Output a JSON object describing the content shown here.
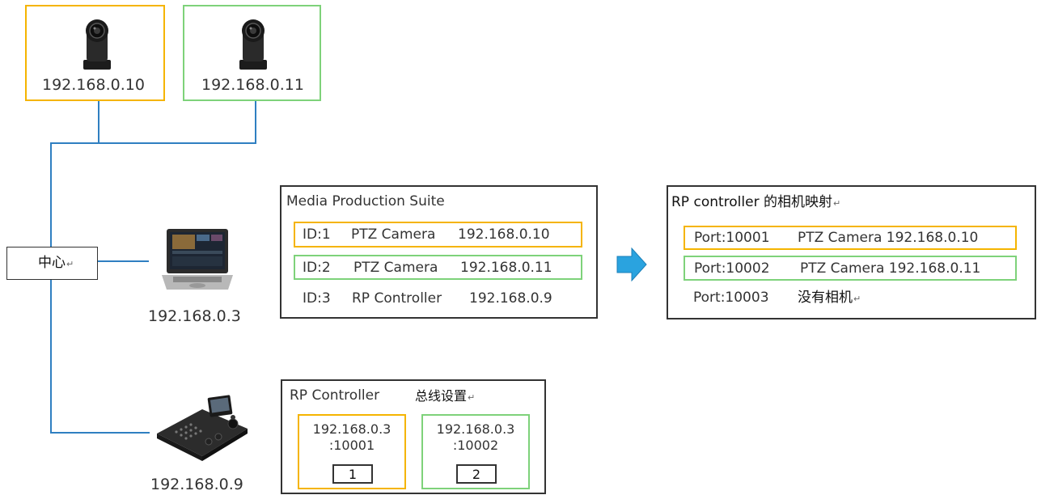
{
  "colors": {
    "orange": "#f5b400",
    "green": "#7ed27a",
    "line_blue": "#2f7fc1",
    "arrow_blue": "#2aa3df",
    "frame": "#333333"
  },
  "cameras": [
    {
      "ip": "192.168.0.10",
      "icon": "ptz-camera-icon"
    },
    {
      "ip": "192.168.0.11",
      "icon": "ptz-camera-icon"
    }
  ],
  "hub": {
    "label": "中心",
    "mark": "↵"
  },
  "laptop": {
    "ip": "192.168.0.3",
    "icon": "laptop-icon"
  },
  "controller": {
    "ip": "192.168.0.9",
    "icon": "rp-controller-icon"
  },
  "mps": {
    "title": "Media Production Suite",
    "rows": [
      {
        "id": "ID:1",
        "name": "PTZ Camera",
        "ip": "192.168.0.10"
      },
      {
        "id": "ID:2",
        "name": "PTZ Camera",
        "ip": "192.168.0.11"
      },
      {
        "id": "ID:3",
        "name": "RP Controller",
        "ip": "192.168.0.9"
      }
    ]
  },
  "mapping": {
    "title": "RP controller 的相机映射",
    "mark": "↵",
    "rows": [
      {
        "port": "Port:10001",
        "value": "PTZ Camera 192.168.0.10"
      },
      {
        "port": "Port:10002",
        "value": "PTZ Camera 192.168.0.11"
      },
      {
        "port": "Port:10003",
        "value": "没有相机",
        "mark": "↵"
      }
    ]
  },
  "rp": {
    "title": "RP Controller",
    "subtitle": "总线设置",
    "mark": "↵",
    "buses": [
      {
        "line1": "192.168.0.3",
        "line2": ":10001",
        "number": "1"
      },
      {
        "line1": "192.168.0.3",
        "line2": ":10002",
        "number": "2"
      }
    ]
  }
}
